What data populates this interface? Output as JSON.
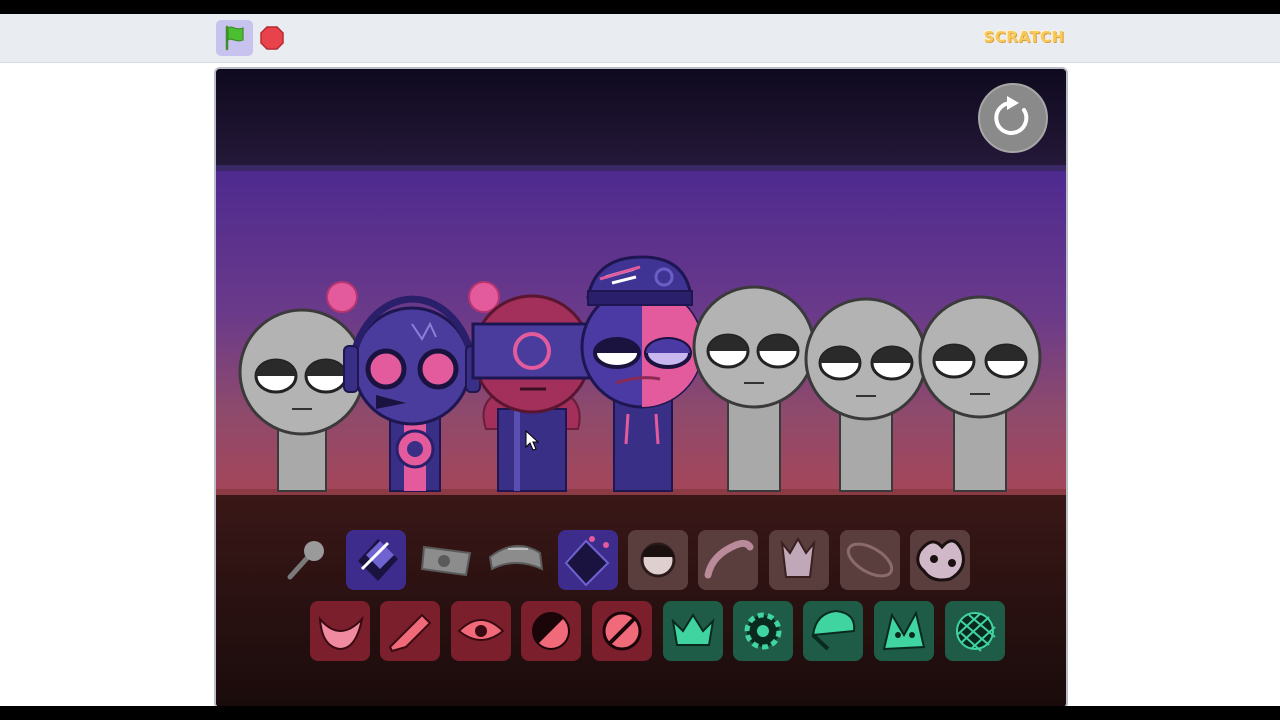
{
  "controls": {
    "green_flag": "flag-icon",
    "stop": "stop-icon",
    "logo_text": "SCRATCH"
  },
  "stage": {
    "reset_button": "rotate-icon",
    "characters": [
      {
        "name": "slot-1",
        "state": "empty",
        "fill": "#b3b3b3"
      },
      {
        "name": "slot-2",
        "state": "headphones-pink-eyes",
        "fill": "#4a3c9c"
      },
      {
        "name": "slot-3",
        "state": "visor-ring",
        "fill": "#a3305a"
      },
      {
        "name": "slot-4",
        "state": "cap-split-face",
        "fill": "#4b3aa3"
      },
      {
        "name": "slot-5",
        "state": "empty",
        "fill": "#b3b3b3"
      },
      {
        "name": "slot-6",
        "state": "empty",
        "fill": "#b3b3b3"
      },
      {
        "name": "slot-7",
        "state": "empty",
        "fill": "#b3b3b3"
      }
    ],
    "sound_row_1": [
      {
        "icon": "microphone-icon",
        "bg": "none"
      },
      {
        "icon": "tape-icon",
        "bg": "#3d2c8c"
      },
      {
        "icon": "cassette-icon",
        "bg": "none"
      },
      {
        "icon": "beak-icon",
        "bg": "none"
      },
      {
        "icon": "gameboy-icon",
        "bg": "#3d2c8c"
      },
      {
        "icon": "eye-dome-icon",
        "bg": "#5a3d3d"
      },
      {
        "icon": "phone-icon",
        "bg": "#5a3d3d"
      },
      {
        "icon": "crown-bag-icon",
        "bg": "#5a3d3d"
      },
      {
        "icon": "ring-icon",
        "bg": "#5a3d3d"
      },
      {
        "icon": "splat-icon",
        "bg": "#5a3d3d"
      }
    ],
    "sound_row_2": [
      {
        "icon": "mouth-icon",
        "bg": "#7a1f2b"
      },
      {
        "icon": "pencil-icon",
        "bg": "#7a1f2b"
      },
      {
        "icon": "eye-icon",
        "bg": "#7a1f2b"
      },
      {
        "icon": "half-circle-icon",
        "bg": "#7a1f2b"
      },
      {
        "icon": "slash-circle-icon",
        "bg": "#7a1f2b"
      },
      {
        "icon": "crown-icon",
        "bg": "#1e5c47"
      },
      {
        "icon": "gear-icon",
        "bg": "#1e5c47"
      },
      {
        "icon": "cap-icon",
        "bg": "#1e5c47"
      },
      {
        "icon": "claw-eyes-icon",
        "bg": "#1e5c47"
      },
      {
        "icon": "net-icon",
        "bg": "#1e5c47"
      }
    ]
  }
}
